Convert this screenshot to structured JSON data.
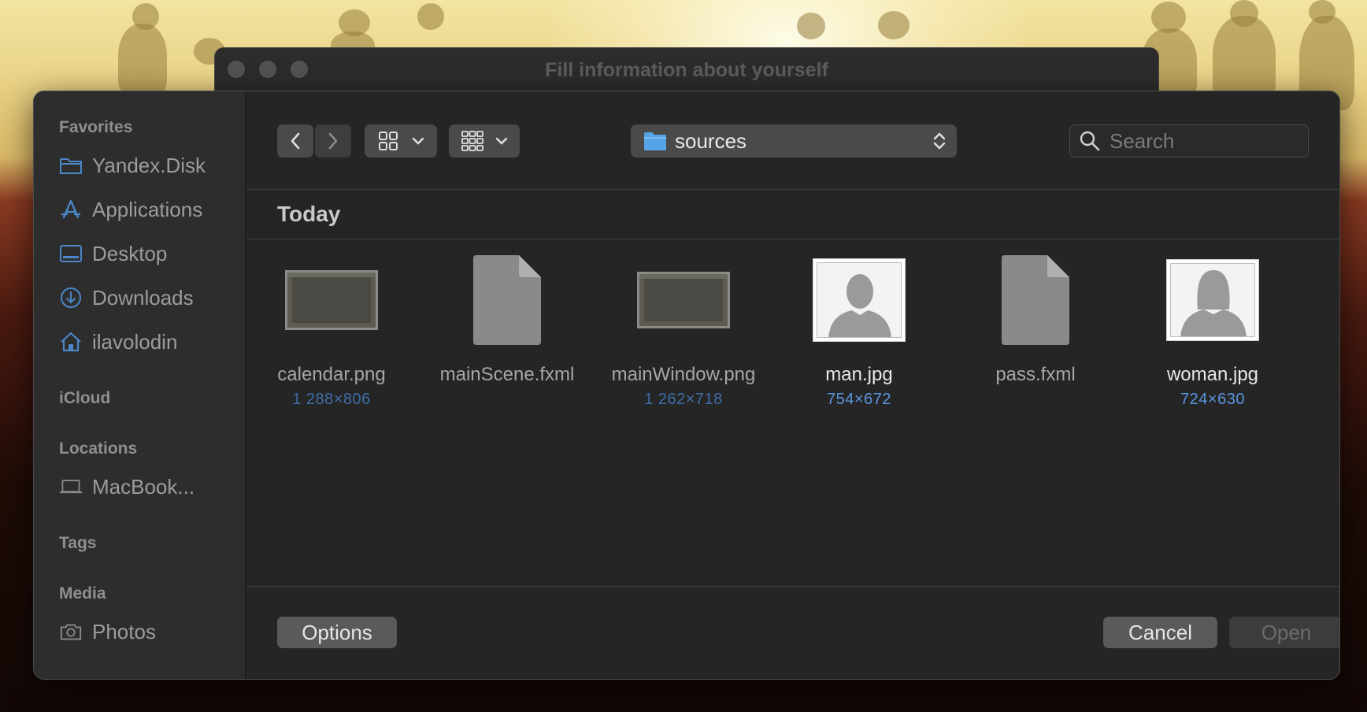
{
  "background_window": {
    "title": "Fill information about yourself"
  },
  "sidebar": {
    "sections": {
      "favorites": "Favorites",
      "icloud": "iCloud",
      "locations": "Locations",
      "tags": "Tags",
      "media": "Media"
    },
    "favorites": [
      {
        "label": "Yandex.Disk",
        "icon": "folder-icon"
      },
      {
        "label": "Applications",
        "icon": "applications-icon"
      },
      {
        "label": "Desktop",
        "icon": "desktop-icon"
      },
      {
        "label": "Downloads",
        "icon": "downloads-icon"
      },
      {
        "label": "ilavolodin",
        "icon": "home-icon"
      }
    ],
    "locations": [
      {
        "label": "MacBook...",
        "icon": "laptop-icon"
      }
    ],
    "media": [
      {
        "label": "Photos",
        "icon": "camera-icon"
      }
    ]
  },
  "toolbar": {
    "current_folder": "sources",
    "search_placeholder": "Search"
  },
  "section": {
    "title": "Today"
  },
  "files": [
    {
      "name": "calendar.png",
      "dims": "1 288×806",
      "type": "screenshot",
      "enabled": false
    },
    {
      "name": "mainScene.fxml",
      "dims": "",
      "type": "document",
      "enabled": false
    },
    {
      "name": "mainWindow.png",
      "dims": "1 262×718",
      "type": "screenshot",
      "enabled": false
    },
    {
      "name": "man.jpg",
      "dims": "754×672",
      "type": "avatar-male",
      "enabled": true
    },
    {
      "name": "pass.fxml",
      "dims": "",
      "type": "document",
      "enabled": false
    },
    {
      "name": "woman.jpg",
      "dims": "724×630",
      "type": "avatar-female",
      "enabled": true
    }
  ],
  "footer": {
    "options_label": "Options",
    "cancel_label": "Cancel",
    "open_label": "Open"
  },
  "colors": {
    "dialog_bg": "#252525",
    "sidebar_bg": "#2e2d2d",
    "accent_blue": "#5a95e0",
    "folder_blue": "#56a4e8"
  }
}
